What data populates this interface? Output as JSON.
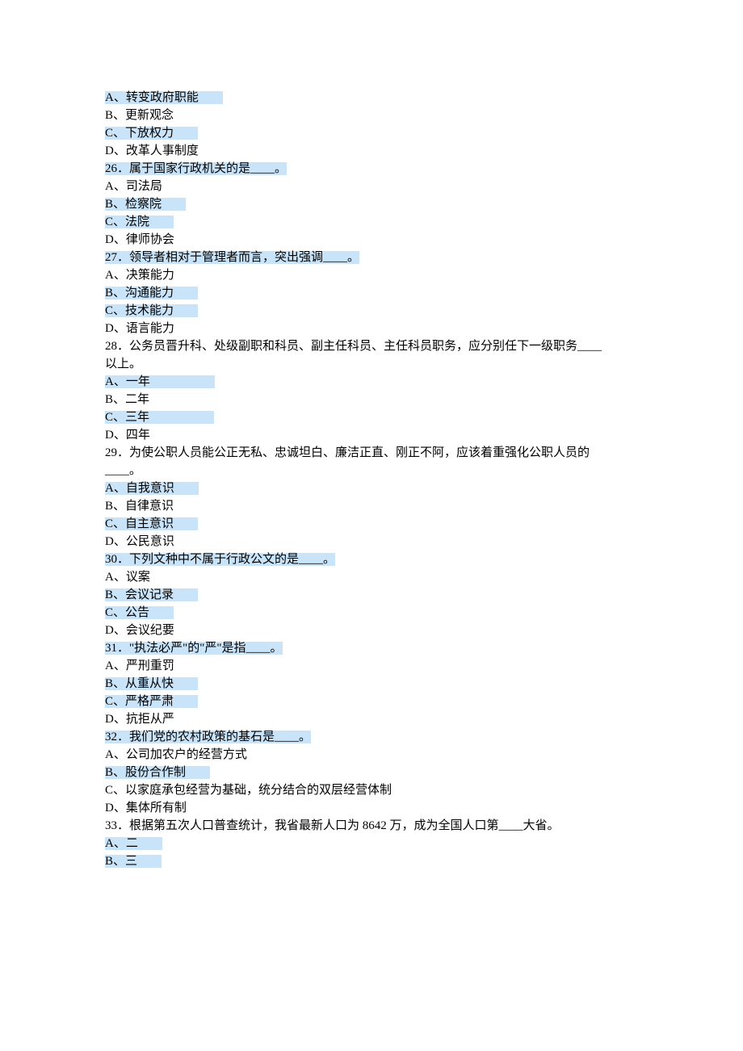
{
  "lines": [
    {
      "hl": true,
      "content": "A、转变政府职能",
      "extra": 30
    },
    {
      "hl": false,
      "content": "B、更新观念"
    },
    {
      "hl": true,
      "content": "C、下放权力",
      "extra": 30
    },
    {
      "hl": false,
      "content": "D、改革人事制度"
    },
    {
      "hl": true,
      "content": "26．属于国家行政机关的是____。"
    },
    {
      "hl": false,
      "content": "A、司法局"
    },
    {
      "hl": true,
      "content": "B、检察院",
      "extra": 30
    },
    {
      "hl": true,
      "content": "C、法院",
      "extra": 30
    },
    {
      "hl": false,
      "content": "D、律师协会"
    },
    {
      "hl": true,
      "content": "27．领导者相对于管理者而言，突出强调____。"
    },
    {
      "hl": false,
      "content": "A、决策能力"
    },
    {
      "hl": true,
      "content": "B、沟通能力",
      "extra": 30
    },
    {
      "hl": true,
      "content": "C、技术能力",
      "extra": 30
    },
    {
      "hl": false,
      "content": "D、语言能力"
    },
    {
      "hl": false,
      "content": "28．公务员晋升科、处级副职和科员、副主任科员、主任科员职务，应分别任下一级职务____"
    },
    {
      "hl": false,
      "content": "以上。"
    },
    {
      "hl": true,
      "content": "A、一年",
      "extra": 80
    },
    {
      "hl": false,
      "content": "B、二年"
    },
    {
      "hl": true,
      "content": "C、三年",
      "extra": 80
    },
    {
      "hl": false,
      "content": "D、四年"
    },
    {
      "hl": false,
      "content": "29．为使公职人员能公正无私、忠诚坦白、廉洁正直、刚正不阿，应该着重强化公职人员的"
    },
    {
      "hl": false,
      "content": "____。"
    },
    {
      "hl": true,
      "content": "A、自我意识",
      "extra": 30
    },
    {
      "hl": false,
      "content": "B、自律意识"
    },
    {
      "hl": true,
      "content": "C、自主意识",
      "extra": 30
    },
    {
      "hl": false,
      "content": "D、公民意识"
    },
    {
      "hl": true,
      "content": "30．下列文种中不属于行政公文的是____。"
    },
    {
      "hl": false,
      "content": "A、议案"
    },
    {
      "hl": true,
      "content": "B、会议记录",
      "extra": 30
    },
    {
      "hl": true,
      "content": "C、公告",
      "extra": 30
    },
    {
      "hl": false,
      "content": "D、会议纪要"
    },
    {
      "hl": true,
      "content": "31．\"执法必严\"的\"严\"是指____。"
    },
    {
      "hl": false,
      "content": "A、严刑重罚"
    },
    {
      "hl": true,
      "content": "B、从重从快",
      "extra": 30
    },
    {
      "hl": true,
      "content": "C、严格严肃",
      "extra": 30
    },
    {
      "hl": false,
      "content": "D、抗拒从严"
    },
    {
      "hl": true,
      "content": "32．我们党的农村政策的基石是____。"
    },
    {
      "hl": false,
      "content": "A、公司加农户的经营方式"
    },
    {
      "hl": true,
      "content": "B、股份合作制",
      "extra": 30
    },
    {
      "hl": false,
      "content": "C、以家庭承包经营为基础，统分结合的双层经营体制"
    },
    {
      "hl": false,
      "content": "D、集体所有制"
    },
    {
      "hl": false,
      "content": "33．根据第五次人口普查统计，我省最新人口为 8642 万，成为全国人口第____大省。"
    },
    {
      "hl": true,
      "content": "A、二",
      "extra": 30
    },
    {
      "hl": true,
      "content": "B、三",
      "extra": 30
    }
  ]
}
